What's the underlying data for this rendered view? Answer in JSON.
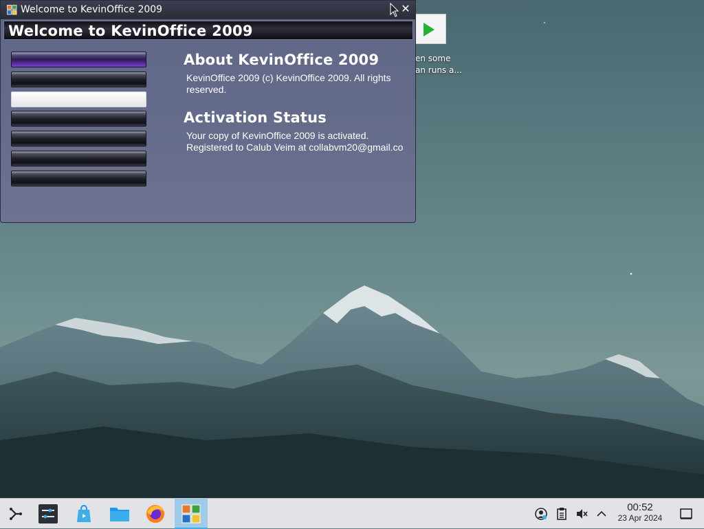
{
  "window": {
    "title": "Welcome to KevinOffice 2009",
    "banner_title": "Welcome to KevinOffice 2009",
    "nav_buttons": [
      "",
      "",
      "",
      "",
      "",
      "",
      ""
    ],
    "about": {
      "heading": "About KevinOffice 2009",
      "line1": "KevinOffice 2009 (c) KevinOffice 2009. All rights",
      "line2": "reserved."
    },
    "activation": {
      "heading": "Activation Status",
      "line1": "Your copy of KevinOffice 2009 is activated.",
      "line2": "Registered to Calub Veim at collabvm20@gmail.co"
    }
  },
  "desktop": {
    "behind_text_line1": "en some",
    "behind_text_line2": "an runs a..."
  },
  "taskbar": {
    "launcher_icons": [
      "application-launcher-icon",
      "system-settings-icon",
      "discover-store-icon",
      "dolphin-folder-icon",
      "firefox-icon",
      "kevinoffice-icon"
    ],
    "tray_icons": [
      "network-icon",
      "clipboard-icon",
      "volume-muted-icon",
      "expand-tray-icon",
      "show-desktop-icon"
    ],
    "time": "00:52",
    "date": "23 Apr 2024"
  },
  "colors": {
    "window_bg": "#656b8a",
    "titlebar_bg": "#2a2c38",
    "active_nav": "#5a2ba5",
    "taskbar_active": "#9fcbe9"
  }
}
